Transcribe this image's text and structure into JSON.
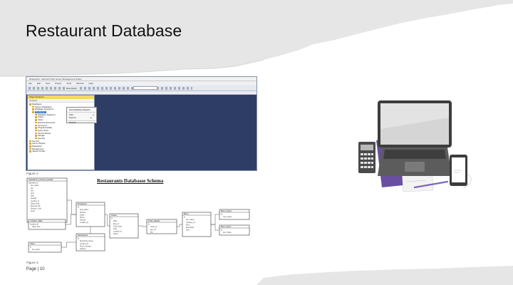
{
  "slide": {
    "title": "Restaurant Database",
    "colors": {
      "band_grey": "#e6e6e6",
      "ssms_workspace": "#2e3d66",
      "schema_line": "#333333",
      "laptop_body": "#5a5a5a",
      "folder_purple": "#6a4fa0"
    }
  },
  "ssms": {
    "window_title": "Restaurant - Microsoft SQL Server Management Studio",
    "menu": [
      "File",
      "Edit",
      "View",
      "Project",
      "Tools",
      "Window",
      "Help"
    ],
    "toolbar_new_query": "New Query",
    "object_explorer": {
      "header": "Object Explorer",
      "connect": "Connect",
      "tree": [
        {
          "label": "Databases",
          "selected": false
        },
        {
          "label": "System Databases",
          "selected": false
        },
        {
          "label": "Database Snapshots",
          "selected": false
        },
        {
          "label": "Restaurant",
          "selected": true
        },
        {
          "label": "Database Diagrams",
          "selected": false
        },
        {
          "label": "Tables",
          "selected": false
        },
        {
          "label": "Views",
          "selected": false
        },
        {
          "label": "External Resources",
          "selected": false
        },
        {
          "label": "Synonyms",
          "selected": false
        },
        {
          "label": "Programmability",
          "selected": false
        },
        {
          "label": "Query Store",
          "selected": false
        },
        {
          "label": "Service Broker",
          "selected": false
        },
        {
          "label": "Storage",
          "selected": false
        },
        {
          "label": "Security",
          "selected": false
        },
        {
          "label": "Security",
          "selected": false
        },
        {
          "label": "Server Objects",
          "selected": false
        },
        {
          "label": "Replication",
          "selected": false
        },
        {
          "label": "Management",
          "selected": false
        },
        {
          "label": "XEvent Profiler",
          "selected": false
        }
      ]
    },
    "context_menu": [
      {
        "label": "New Database Diagram",
        "submenu": false
      },
      {
        "label": "Filter",
        "submenu": true
      },
      {
        "label": "Reports",
        "submenu": true
      },
      {
        "label": "Refresh",
        "submenu": false
      }
    ]
  },
  "figure2_caption": "Figure 2",
  "schema": {
    "title": "Restaurants Databasse Schema",
    "tables": [
      {
        "name": "Ingredients_Inventory_Details",
        "fields": [
          "Ingredient_Id",
          "Item_Name",
          "Qty",
          "Unit",
          "Cost",
          "Date",
          "Supplier",
          "Location_Id",
          "Expiry_Date",
          "Received_By",
          "Reorder_Level",
          "Notes"
        ]
      },
      {
        "name": "Employees",
        "fields": [
          "Id",
          "Emp_Name",
          "Position",
          "Salary",
          "Phone",
          "Address",
          "Location_Id"
        ]
      },
      {
        "name": "Orders",
        "fields": [
          "Id",
          "Table",
          "Emp_Id",
          "Order_Date",
          "Total",
          "Location_Id",
          "Status"
        ]
      },
      {
        "name": "Order_Details",
        "fields": [
          "Id",
          "Order_Id",
          "Item_Id",
          "Qty"
        ]
      },
      {
        "name": "Menu",
        "fields": [
          "Id",
          "Item_Name",
          "Category_Id",
          "Price",
          "Description",
          "Type"
        ]
      },
      {
        "name": "Menu_Types",
        "fields": [
          "Id",
          "Type_Name"
        ]
      },
      {
        "name": "Menu_Items",
        "fields": [
          "Id",
          "Item_Name"
        ]
      },
      {
        "name": "Location_Table",
        "fields": [
          "Location_Id",
          "Table_Num"
        ]
      },
      {
        "name": "Restaurants",
        "fields": [
          "Id",
          "Restaurant_Name",
          "Location_Id",
          "Phone_Number",
          "Address"
        ]
      },
      {
        "name": "Cities",
        "fields": [
          "Id",
          "City_Name"
        ]
      }
    ]
  },
  "figure3_caption": "Figure 3",
  "footer": "Page | 10"
}
